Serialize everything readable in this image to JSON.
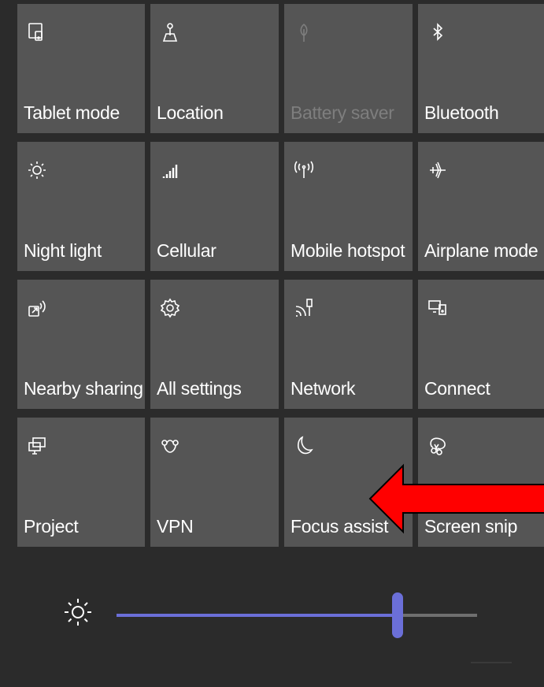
{
  "tiles": [
    {
      "label": "Tablet mode",
      "icon": "tablet-mode-icon",
      "enabled": true
    },
    {
      "label": "Location",
      "icon": "location-icon",
      "enabled": true
    },
    {
      "label": "Battery saver",
      "icon": "battery-saver-icon",
      "enabled": false
    },
    {
      "label": "Bluetooth",
      "icon": "bluetooth-icon",
      "enabled": true
    },
    {
      "label": "Night light",
      "icon": "night-light-icon",
      "enabled": true
    },
    {
      "label": "Cellular",
      "icon": "cellular-icon",
      "enabled": true
    },
    {
      "label": "Mobile hotspot",
      "icon": "mobile-hotspot-icon",
      "enabled": true
    },
    {
      "label": "Airplane mode",
      "icon": "airplane-icon",
      "enabled": true
    },
    {
      "label": "Nearby sharing",
      "icon": "nearby-sharing-icon",
      "enabled": true
    },
    {
      "label": "All settings",
      "icon": "gear-icon",
      "enabled": true
    },
    {
      "label": "Network",
      "icon": "network-icon",
      "enabled": true
    },
    {
      "label": "Connect",
      "icon": "connect-icon",
      "enabled": true
    },
    {
      "label": "Project",
      "icon": "project-icon",
      "enabled": true
    },
    {
      "label": "VPN",
      "icon": "vpn-icon",
      "enabled": true
    },
    {
      "label": "Focus assist",
      "icon": "moon-icon",
      "enabled": true
    },
    {
      "label": "Screen snip",
      "icon": "screen-snip-icon",
      "enabled": true
    }
  ],
  "brightness": {
    "icon": "sun-icon",
    "level": 0.78
  },
  "colors": {
    "background": "#2b2b2b",
    "tile": "#555555",
    "accent": "#6b6fd8",
    "annotation_arrow": "#ff0000"
  }
}
